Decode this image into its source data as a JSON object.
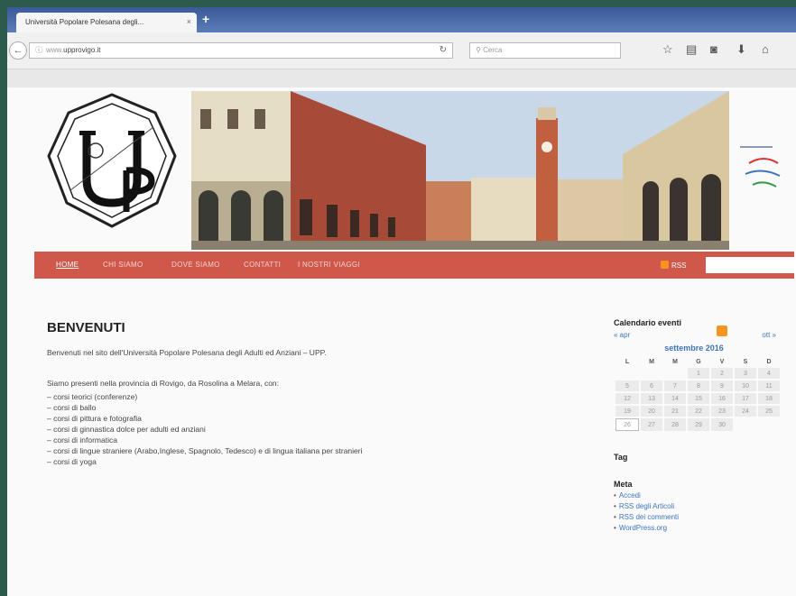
{
  "browser": {
    "tab_title": "Università Popolare Polesana degli...",
    "tab_close": "×",
    "new_tab": "+",
    "url_prefix": "www.",
    "url_domain": "upprovigo.it",
    "search_placeholder": "Cerca",
    "reload_icon": "reload-icon",
    "toolbar_icons": [
      "star-icon",
      "bookmark-icon",
      "pocket-icon",
      "download-icon",
      "home-icon"
    ]
  },
  "site": {
    "menu": [
      {
        "label": "HOME",
        "active": true
      },
      {
        "label": "CHI SIAMO",
        "active": false
      },
      {
        "label": "DOVE SIAMO",
        "active": false
      },
      {
        "label": "CONTATTI",
        "active": false
      },
      {
        "label": "I NOSTRI VIAGGI",
        "active": false
      }
    ],
    "rss_label": "RSS"
  },
  "main": {
    "title": "BENVENUTI",
    "intro": "Benvenuti nel sito dell'Università Popolare Polesana degli Adulti ed Anziani – UPP.",
    "paragraph": "Siamo presenti nella provincia di Rovigo, da Rosolina a Melara, con:",
    "items": [
      "– corsi teorici (conferenze)",
      "– corsi di ballo",
      "– corsi di pittura e fotografia",
      "– corsi di ginnastica dolce per adulti ed anziani",
      "– corsi di informatica",
      "– corsi di lingue straniere (Arabo,Inglese, Spagnolo, Tedesco) e di lingua italiana per stranieri",
      "– corsi di yoga"
    ]
  },
  "sidebar": {
    "calendar_title": "Calendario eventi",
    "prev": "« apr",
    "next": "ott »",
    "month": "settembre 2016",
    "weekdays": [
      "L",
      "M",
      "M",
      "G",
      "V",
      "S",
      "D"
    ],
    "weeks": [
      [
        "",
        "",
        "",
        "1",
        "2",
        "3",
        "4"
      ],
      [
        "5",
        "6",
        "7",
        "8",
        "9",
        "10",
        "11"
      ],
      [
        "12",
        "13",
        "14",
        "15",
        "16",
        "17",
        "18"
      ],
      [
        "19",
        "20",
        "21",
        "22",
        "23",
        "24",
        "25"
      ],
      [
        "26",
        "27",
        "28",
        "29",
        "30",
        "",
        ""
      ]
    ],
    "today": "26",
    "tag_title": "Tag",
    "meta_title": "Meta",
    "meta_links": [
      "Accedi",
      "RSS degli Articoli",
      "RSS dei commenti",
      "WordPress.org"
    ]
  },
  "colors": {
    "menu_bar": "#d0584a",
    "link": "#3a75c4",
    "tab_bar": "#3b5998"
  }
}
